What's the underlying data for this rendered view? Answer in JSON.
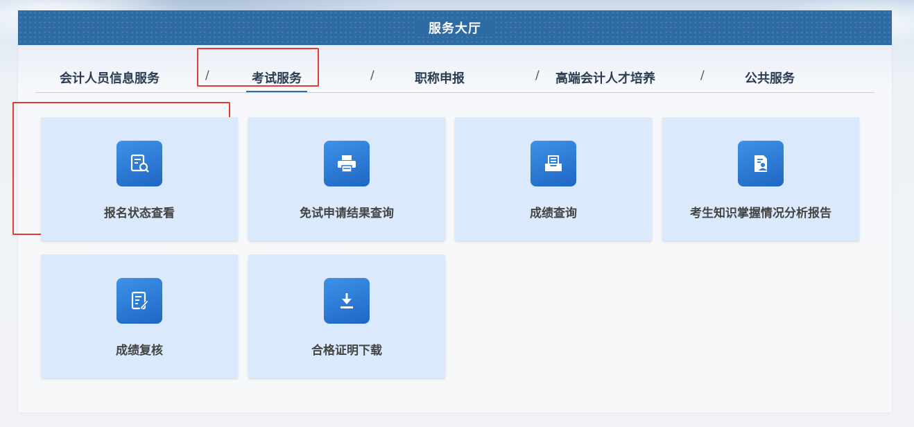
{
  "page": {
    "title": "服务大厅"
  },
  "tabs": [
    {
      "label": "会计人员信息服务"
    },
    {
      "label": "考试服务",
      "active": true
    },
    {
      "label": "职称申报"
    },
    {
      "label": "高端会计人才培养"
    },
    {
      "label": "公共服务"
    }
  ],
  "separator": "/",
  "cards": [
    {
      "label": "报名状态查看",
      "icon": "search-document-icon"
    },
    {
      "label": "免试申请结果查询",
      "icon": "printer-icon"
    },
    {
      "label": "成绩查询",
      "icon": "inbox-tray-icon"
    },
    {
      "label": "考生知识掌握情况分析报告",
      "icon": "profile-report-icon"
    },
    {
      "label": "成绩复核",
      "icon": "edit-document-icon"
    },
    {
      "label": "合格证明下载",
      "icon": "download-icon"
    }
  ],
  "colors": {
    "header": "#2e6aa3",
    "card": "#dae9fb",
    "icon": "#2a7ad6",
    "highlight": "#e53935"
  }
}
